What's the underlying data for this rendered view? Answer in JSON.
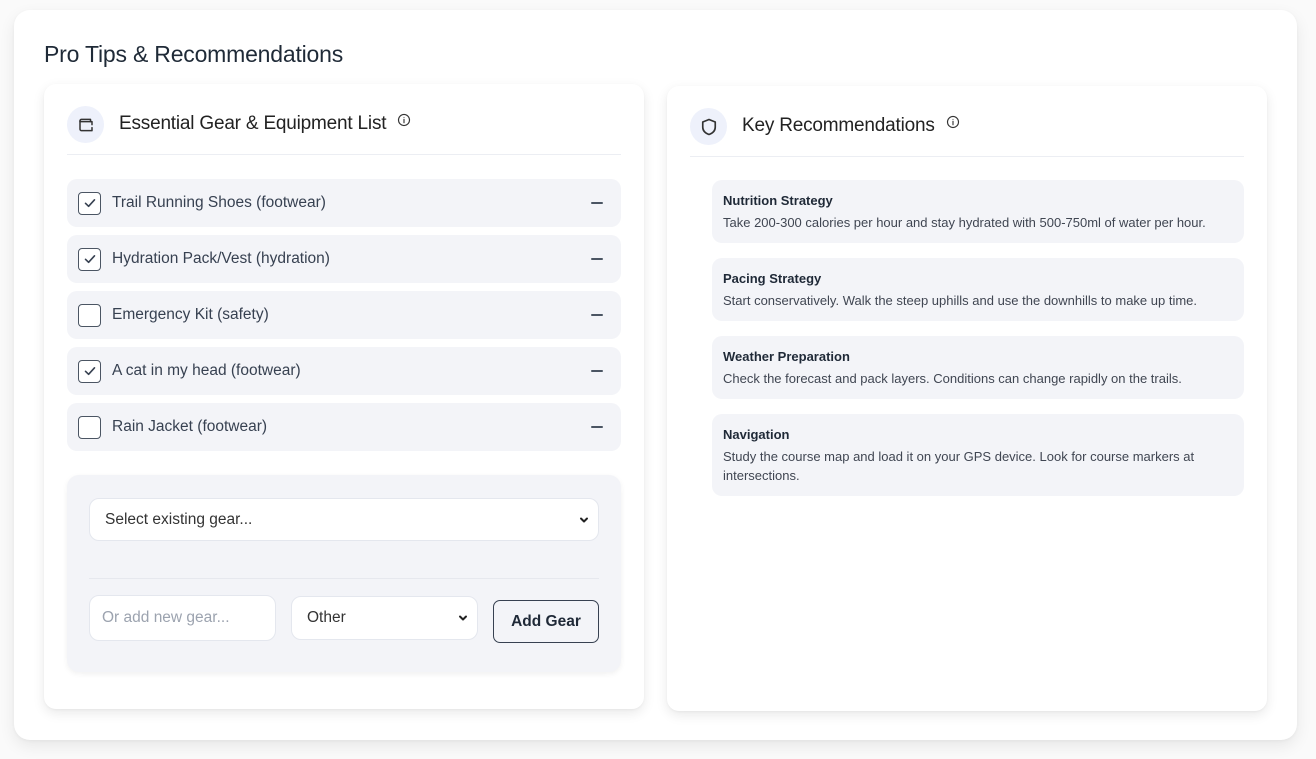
{
  "page": {
    "title": "Pro Tips & Recommendations"
  },
  "gear": {
    "title": "Essential Gear & Equipment List",
    "header_icon": "wallet-icon",
    "items": [
      {
        "label": "Trail Running Shoes (footwear)",
        "checked": true
      },
      {
        "label": "Hydration Pack/Vest (hydration)",
        "checked": true
      },
      {
        "label": "Emergency Kit (safety)",
        "checked": false
      },
      {
        "label": "A cat in my head (footwear)",
        "checked": true
      },
      {
        "label": "Rain Jacket (footwear)",
        "checked": false
      }
    ],
    "select_existing": {
      "value": "Select existing gear..."
    },
    "new_gear": {
      "value": "",
      "placeholder": "Or add new gear..."
    },
    "category": {
      "value": "Other"
    },
    "add_button": "Add Gear"
  },
  "recommendations": {
    "title": "Key Recommendations",
    "header_icon": "shield-icon",
    "items": [
      {
        "title": "Nutrition Strategy",
        "description": "Take 200-300 calories per hour and stay hydrated with 500-750ml of water per hour."
      },
      {
        "title": "Pacing Strategy",
        "description": "Start conservatively. Walk the steep uphills and use the downhills to make up time."
      },
      {
        "title": "Weather Preparation",
        "description": "Check the forecast and pack layers. Conditions can change rapidly on the trails."
      },
      {
        "title": "Navigation",
        "description": "Study the course map and load it on your GPS device. Look for course markers at intersections."
      }
    ]
  },
  "colors": {
    "item_bg": "#f3f4f8",
    "icon_circle_bg": "#eef1fb",
    "text_primary": "#1f2937"
  }
}
